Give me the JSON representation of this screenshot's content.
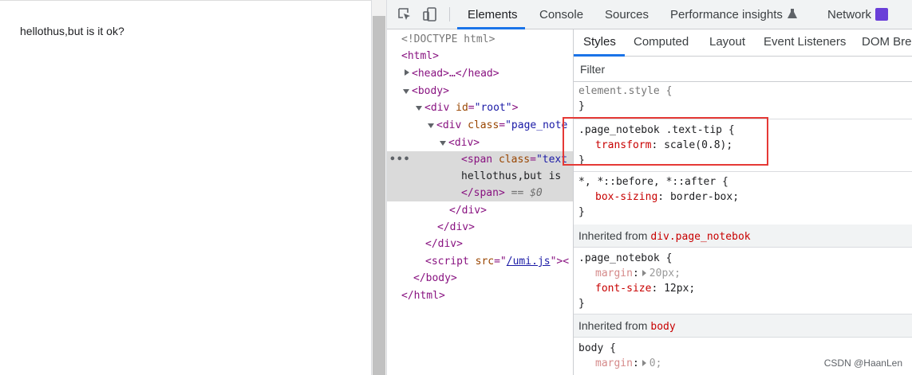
{
  "page": {
    "text": "hellothus,but is it ok?"
  },
  "toolbar": {
    "icons": [
      "inspect-icon",
      "device-toggle-icon",
      "extension-icon"
    ],
    "tabs": [
      {
        "label": "Elements",
        "active": true
      },
      {
        "label": "Console"
      },
      {
        "label": "Sources"
      },
      {
        "label": "Performance insights"
      },
      {
        "label": "Network"
      }
    ]
  },
  "dom": {
    "doctype": "<!DOCTYPE html>",
    "html_open": "<html>",
    "head": "<head>…</head>",
    "body_open": "<body>",
    "div_root_tag": "<div ",
    "div_root_attr": "id",
    "div_root_val": "\"root\"",
    "div_root_close": ">",
    "div_page_tag": "<div ",
    "div_page_attr": "class",
    "div_page_val": "\"page_note",
    "div_inner": "<div>",
    "span_tag": "<span ",
    "span_attr": "class",
    "span_val": "\"text",
    "span_text": "hellothus,but is",
    "span_close": "</span>",
    "span_dollar": "== $0",
    "div_close_1": "</div>",
    "div_close_2": "</div>",
    "div_close_3": "</div>",
    "script_tag": "<script ",
    "script_attr": "src",
    "script_eq": "=\"",
    "script_src": "/umi.js",
    "script_end": "\"><",
    "body_close": "</body>",
    "html_close": "</html>",
    "ellipsis": "•••"
  },
  "styles": {
    "subtabs": [
      "Styles",
      "Computed",
      "Layout",
      "Event Listeners",
      "DOM Brea"
    ],
    "filter_placeholder": "Filter",
    "element_style_selector": "element.style {",
    "close_brace": "}",
    "rule1_selector": ".page_notebok .text-tip {",
    "rule1_prop": "transform",
    "rule1_val": "scale(0.8);",
    "rule2_selector": "*, *::before, *::after {",
    "rule2_prop": "box-sizing",
    "rule2_val": "border-box;",
    "inherited_label": "Inherited from",
    "inherited1_from": "div.page_notebok",
    "rule3_selector": ".page_notebok {",
    "rule3_prop1": "margin",
    "rule3_val1": "20px;",
    "rule3_prop2": "font-size",
    "rule3_val2": "12px;",
    "inherited2_from": "body",
    "rule4_selector": "body {",
    "rule4_prop1": "margin",
    "rule4_val1": "0;"
  },
  "watermark": "CSDN @HaanLen",
  "colors": {
    "accent": "#1a73e8",
    "highlight": "#e53935"
  }
}
